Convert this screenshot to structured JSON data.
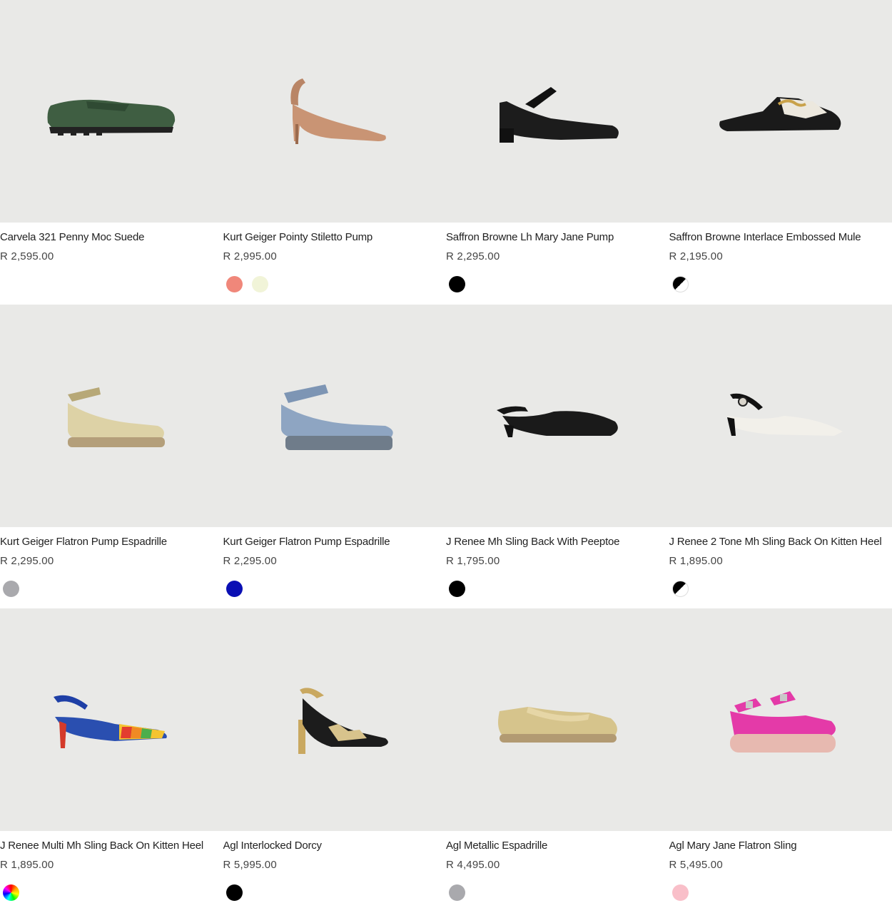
{
  "products": [
    {
      "name": "Carvela 321 Penny Moc Suede",
      "price": "R 2,595.00",
      "image": "green-suede-loafer",
      "swatches": []
    },
    {
      "name": "Kurt Geiger Pointy Stiletto Pump",
      "price": "R 2,995.00",
      "image": "nude-slingback-stiletto",
      "swatches": [
        "#f0877a",
        "#f1f4d8"
      ]
    },
    {
      "name": "Saffron Browne Lh Mary Jane Pump",
      "price": "R 2,295.00",
      "image": "black-mary-jane-pump",
      "swatches": [
        "#000000"
      ]
    },
    {
      "name": "Saffron Browne Interlace Embossed Mule",
      "price": "R 2,195.00",
      "image": "black-white-chain-mule",
      "swatches": [
        "black-white"
      ]
    },
    {
      "name": "Kurt Geiger Flatron Pump Espadrille",
      "price": "R 2,295.00",
      "image": "beige-espadrille",
      "swatches": [
        "#a9a9ad"
      ]
    },
    {
      "name": "Kurt Geiger Flatron Pump Espadrille",
      "price": "R 2,295.00",
      "image": "denim-espadrille",
      "swatches": [
        "#0a0fb4"
      ]
    },
    {
      "name": "J Renee Mh Sling Back With Peeptoe",
      "price": "R 1,795.00",
      "image": "black-peeptoe-slingback",
      "swatches": [
        "#000000"
      ]
    },
    {
      "name": "J Renee 2 Tone Mh Sling Back On Kitten Heel",
      "price": "R 1,895.00",
      "image": "white-black-kitten-slingback",
      "swatches": [
        "black-white"
      ]
    },
    {
      "name": "J Renee Multi Mh Sling Back On Kitten Heel",
      "price": "R 1,895.00",
      "image": "rainbow-kitten-slingback",
      "swatches": [
        "multi"
      ]
    },
    {
      "name": "Agl Interlocked Dorcy",
      "price": "R 5,995.00",
      "image": "gold-black-woven-sandal",
      "swatches": [
        "#000000"
      ]
    },
    {
      "name": "Agl Metallic Espadrille",
      "price": "R 4,495.00",
      "image": "gold-metallic-espadrille",
      "swatches": [
        "#a9a9ad"
      ]
    },
    {
      "name": "Agl Mary Jane Flatron Sling",
      "price": "R 5,495.00",
      "image": "pink-platform-mary-jane",
      "swatches": [
        "#f9bfc9"
      ]
    }
  ]
}
